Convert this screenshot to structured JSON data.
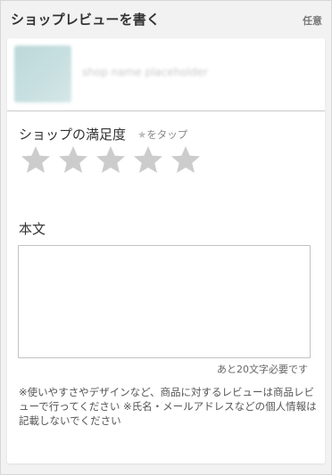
{
  "header": {
    "title": "ショップレビューを書く",
    "optional_label": "任意"
  },
  "shop": {
    "name": "shop name placeholder"
  },
  "rating": {
    "title": "ショップの満足度",
    "hint_star": "★",
    "hint_text": "をタップ",
    "max_stars": 5,
    "selected": 0,
    "star_color": "#cccccc"
  },
  "body": {
    "label": "本文",
    "value": "",
    "char_count_text": "あと20文字必要です"
  },
  "note": "※使いやすさやデザインなど、商品に対するレビューは商品レビューで行ってください ※氏名・メールアドレスなどの個人情報は記載しないでください"
}
